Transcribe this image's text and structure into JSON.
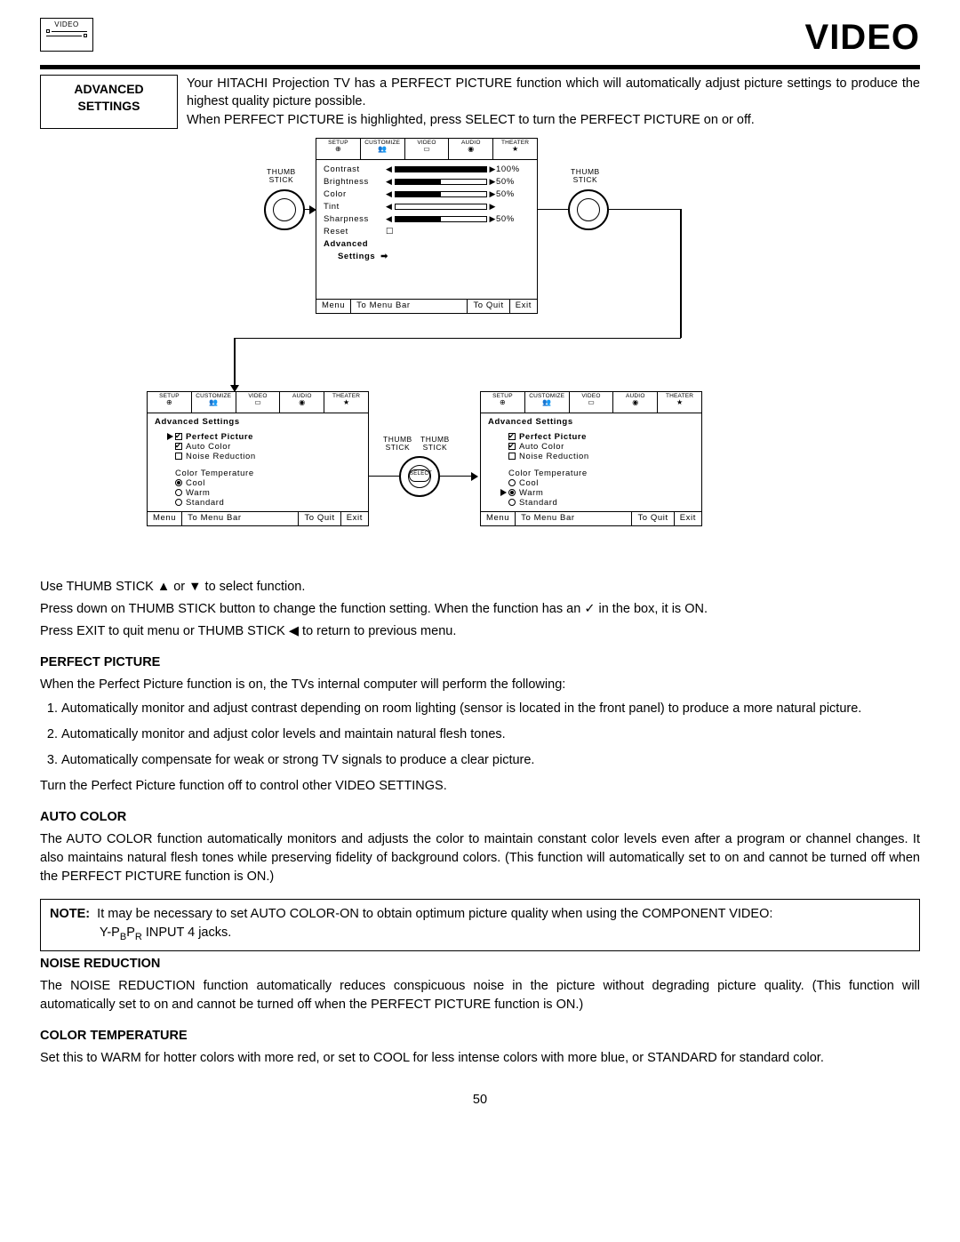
{
  "header": {
    "icon_label": "VIDEO",
    "title": "VIDEO"
  },
  "adv_box": {
    "line1": "ADVANCED",
    "line2": "SETTINGS"
  },
  "intro": {
    "p1": "Your HITACHI Projection TV has a PERFECT PICTURE function which will automatically adjust picture settings to produce the highest quality picture possible.",
    "p2": "When PERFECT PICTURE is highlighted, press SELECT to turn the PERFECT PICTURE on or off."
  },
  "tabs": [
    "SETUP",
    "CUSTOMIZE",
    "VIDEO",
    "AUDIO",
    "THEATER"
  ],
  "panel1": {
    "rows": [
      {
        "label": "Contrast",
        "pct": "100%"
      },
      {
        "label": "Brightness",
        "pct": "50%"
      },
      {
        "label": "Color",
        "pct": "50%"
      },
      {
        "label": "Tint",
        "pct": ""
      },
      {
        "label": "Sharpness",
        "pct": "50%"
      },
      {
        "label": "Reset",
        "pct": ""
      }
    ],
    "adv1": "Advanced",
    "adv2": "Settings",
    "foot": {
      "menu": "Menu",
      "bar": "To Menu Bar",
      "quit": "To Quit",
      "exit": "Exit"
    }
  },
  "panel2": {
    "title": "Advanced Settings",
    "items": {
      "pp": "Perfect Picture",
      "ac": "Auto Color",
      "nr": "Noise Reduction",
      "ct": "Color Temperature",
      "cool": "Cool",
      "warm": "Warm",
      "std": "Standard"
    },
    "foot": {
      "menu": "Menu",
      "bar": "To Menu Bar",
      "quit": "To Quit",
      "exit": "Exit"
    }
  },
  "panel3": {
    "title": "Advanced Settings",
    "items": {
      "pp": "Perfect Picture",
      "ac": "Auto Color",
      "nr": "Noise Reduction",
      "ct": "Color Temperature",
      "cool": "Cool",
      "warm": "Warm",
      "std": "Standard"
    },
    "foot": {
      "menu": "Menu",
      "bar": "To Menu Bar",
      "quit": "To Quit",
      "exit": "Exit"
    }
  },
  "labels": {
    "thumb": "THUMB\nSTICK",
    "select": "SELECT"
  },
  "instructions": {
    "l1": "Use THUMB STICK ▲ or ▼ to select function.",
    "l2a": "Press down on THUMB STICK button to change the function setting. When the function has an ",
    "l2b": " in the box, it is ON.",
    "l3": "Press EXIT to quit menu or THUMB STICK ◀ to return to previous menu."
  },
  "perfect": {
    "head": "PERFECT PICTURE",
    "intro": "When the Perfect Picture function is on, the TVs  internal computer will perform the following:",
    "li1": "Automatically monitor and adjust contrast depending on room lighting (sensor is located in the front panel) to produce a more natural picture.",
    "li2": "Automatically monitor and adjust color levels and maintain natural flesh tones.",
    "li3": "Automatically compensate for weak or strong TV signals to produce a clear picture.",
    "off": "Turn the Perfect Picture function off to control other VIDEO SETTINGS."
  },
  "auto": {
    "head": "AUTO COLOR",
    "body": "The AUTO COLOR function automatically monitors and adjusts the color to maintain constant color levels even after a program or channel changes. It also maintains natural flesh tones while preserving fidelity of background colors. (This function will automatically set to on and cannot be turned off when the PERFECT PICTURE function is ON.)"
  },
  "note": {
    "label": "NOTE:",
    "text": "It may be necessary to set AUTO COLOR-ON to obtain optimum picture quality when using the COMPONENT VIDEO:",
    "text2": "Y-P",
    "text3": " INPUT 4 jacks."
  },
  "noise": {
    "head": "NOISE REDUCTION",
    "body": "The NOISE REDUCTION function automatically reduces conspicuous noise in the picture without degrading picture quality. (This function will automatically set to on and cannot be turned off when the PERFECT PICTURE function is ON.)"
  },
  "colortemp": {
    "head": "COLOR TEMPERATURE",
    "body": "Set this to WARM for hotter colors with more red, or set to COOL for less intense colors with more blue, or STANDARD for standard color."
  },
  "page": "50"
}
